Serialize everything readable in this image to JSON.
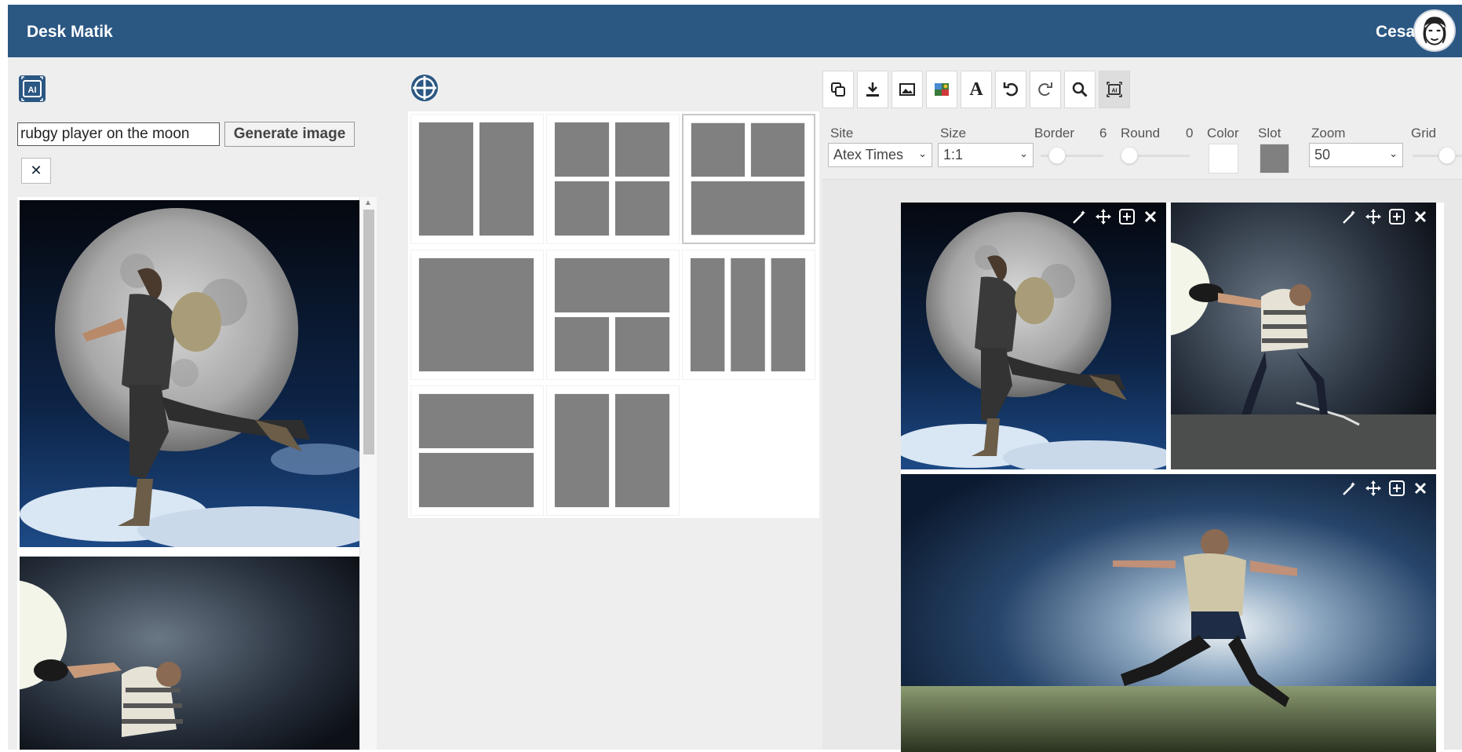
{
  "header": {
    "brand": "Desk Matik",
    "user_name": "Cesare"
  },
  "left_panel": {
    "prompt_value": "rubgy player on the moon",
    "generate_label": "Generate image",
    "clear_icon": "close-icon",
    "results": [
      {
        "subject": "rugby player running in front of full moon",
        "icon": "generated-image"
      },
      {
        "subject": "rugby player throwing ball in space",
        "icon": "generated-image"
      }
    ]
  },
  "middle_panel": {
    "grid_icon": "layout-grid-icon",
    "layouts": [
      {
        "id": "2col",
        "selected": false
      },
      {
        "id": "2x2",
        "selected": false
      },
      {
        "id": "2top-1bottom",
        "selected": true
      },
      {
        "id": "single",
        "selected": false
      },
      {
        "id": "1top-2bottom",
        "selected": false
      },
      {
        "id": "3col",
        "selected": false
      },
      {
        "id": "2row",
        "selected": false
      },
      {
        "id": "2col-b",
        "selected": false
      }
    ]
  },
  "right_panel": {
    "toolbar": [
      "copy-icon",
      "download-icon",
      "image-icon",
      "image-edit-icon",
      "text-icon",
      "undo-icon",
      "redo-icon",
      "zoom-icon",
      "ai-icon"
    ],
    "controls": {
      "site_label": "Site",
      "site_value": "Atex Times",
      "size_label": "Size",
      "size_value": "1:1",
      "border_label": "Border",
      "border_value": "6",
      "round_label": "Round",
      "round_value": "0",
      "color_label": "Color",
      "color_value": "#ffffff",
      "slot_label": "Slot",
      "slot_value": "#808080",
      "zoom_label": "Zoom",
      "zoom_value": "50",
      "grid_label": "Grid"
    },
    "slot_tools": [
      "magic-wand-icon",
      "move-icon",
      "fit-icon",
      "close-icon"
    ]
  },
  "colors": {
    "header": "#2b5783",
    "panel_bg": "#eeeeee",
    "slot_gray": "#808080"
  }
}
